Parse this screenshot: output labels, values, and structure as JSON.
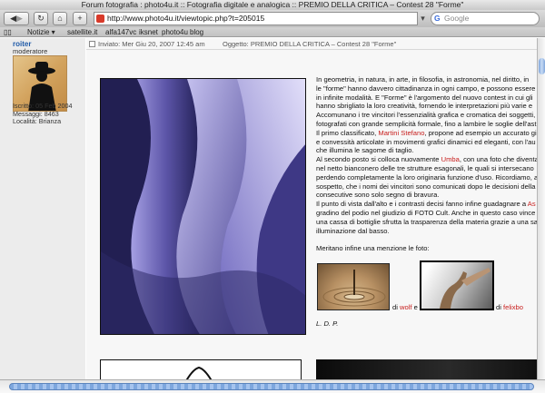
{
  "window": {
    "title": "Forum fotografia : photo4u.it :: Fotografia digitale e analogica :: PREMIO DELLA CRITICA – Contest 28 \"Forme\""
  },
  "toolbar": {
    "back_icon": "back-arrow-icon",
    "forward_icon": "forward-arrow-icon",
    "reload_icon": "reload-icon",
    "home_icon": "home-icon",
    "add_icon": "plus-icon",
    "url": "http://www.photo4u.it/viewtopic.php?t=205015",
    "search_placeholder": "Google"
  },
  "bookmarks": {
    "items": [
      "Notizie ▾",
      "satellite.it",
      "alfa147vc",
      "iksnet",
      "photo4u",
      "blog"
    ]
  },
  "poster": {
    "username": "roiter",
    "rank": "moderatore",
    "joined": "Iscritto: 05 Feb 2004",
    "messages": "Messaggi: 8463",
    "location": "Località: Brianza"
  },
  "post": {
    "sent": "Inviato: Mer Giu 20, 2007 12:45 am",
    "subject": "Oggetto: PREMIO DELLA CRITICA – Contest 28 \"Forme\""
  },
  "article": {
    "l1": "In geometria, in natura, in arte, in filosofia, in astronomia, nel diritto, in",
    "l2": "le \"forme\" hanno davvero cittadinanza in ogni campo, e possono essere",
    "l3": "in infinite modalità. E \"Forme\" è l'argomento del nuovo contest in cui gli",
    "l4": "hanno sbrigliato la loro creatività, fornendo le interpretazioni più varie e",
    "l5": "Accomunano i tre vincitori l'essenzialità grafica e cromatica dei soggetti,",
    "l6": "fotografati con grande semplicità formale, fino a lambire le soglie dell'astr",
    "l7a": "Il primo classificato, ",
    "l7name": "Martini Stefano",
    "l7b": ", propone ad esempio un accurato gio",
    "l8": "e convessità articolate in movimenti grafici dinamici ed eleganti, con l'au",
    "l9": "che illumina le sagome di taglio.",
    "l10a": "Al secondo posto si colloca nuovamente ",
    "l10name": "Umba",
    "l10b": ", con una foto che diventa",
    "l11": "nel netto bianconero delle tre strutture esagonali, le quali si intersecano",
    "l12": "perdendo completamente la loro originaria funzione d'uso. Ricordiamo, a",
    "l13": "sospetto, che i nomi dei vincitori sono comunicati dopo le decisioni della g",
    "l14": "consecutive sono solo segno di bravura.",
    "l15a": "Il punto di vista dall'alto e i contrasti decisi fanno infine guadagnare a ",
    "l15name": "As",
    "l16": "gradino del podio nel giudizio di FOTO Cult. Anche in questo caso vince la",
    "l17": "una cassa di bottiglie sfrutta la trasparenza della materia grazie a una sa",
    "l18": "illuminazione dal basso.",
    "l19": "Meritano infine una menzione le foto:",
    "mention1_prefix": "di ",
    "mention1_name": "wolf",
    "mention1_suffix": " e",
    "mention2_prefix": "di ",
    "mention2_name": "felixbo",
    "signature": "L. D. P."
  },
  "colors": {
    "link_red": "#c8201f",
    "username_blue": "#1f5aa8",
    "scroll_blue": "#7ea7de"
  }
}
